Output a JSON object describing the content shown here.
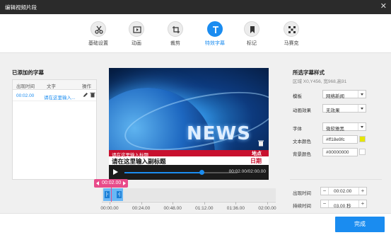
{
  "window": {
    "title": "编辑视频片段",
    "close_glyph": "✕"
  },
  "toolbar": {
    "items": [
      {
        "label": "基础设置",
        "icon": "scissors-icon"
      },
      {
        "label": "动画",
        "icon": "play-box-icon"
      },
      {
        "label": "裁剪",
        "icon": "crop-icon"
      },
      {
        "label": "特效字幕",
        "icon": "text-t-icon",
        "active": true
      },
      {
        "label": "标记",
        "icon": "bookmark-icon"
      },
      {
        "label": "马赛克",
        "icon": "mosaic-icon"
      }
    ]
  },
  "subtitles_panel": {
    "title": "已添加的字幕",
    "columns": [
      "出现时间",
      "文字",
      "操作"
    ],
    "rows": [
      {
        "time": "00:02.00",
        "text": "请在这里输入..."
      }
    ]
  },
  "preview": {
    "news_text": "NEWS",
    "caption_red_text": "请在这里输入标题",
    "caption_red_right": "地点",
    "caption_white_text": "请在这里输入副标题",
    "caption_white_right": "日期",
    "time_display": "00:02.00/02:00.00",
    "progress_fraction": 0.68
  },
  "timeline": {
    "current_time": "00:02.00",
    "clip_left_handle": "[‹",
    "clip_right_handle": "›]",
    "ticks": [
      "00:00.00",
      "00:24.00",
      "00:48.00",
      "01:12.00",
      "01:36.00",
      "02:00.00"
    ]
  },
  "style_panel": {
    "title": "所选字幕样式",
    "region": "区域 X0,Y456, 宽968,高91",
    "template_label": "模板",
    "template_value": "网络新闻",
    "animation_label": "动画效果",
    "animation_value": "无效果",
    "font_label": "字体",
    "font_value": "微软雅黑",
    "text_color_label": "文本颜色",
    "text_color_value": "#ff18e9fc",
    "text_color_swatch": "#e6e600",
    "bg_color_label": "背景颜色",
    "bg_color_value": "#00000000",
    "bg_color_swatch": "#ffffff",
    "appear_label": "出现时间",
    "appear_value": "00:02.00",
    "duration_label": "持续时间",
    "duration_value": "03.00 秒"
  },
  "footer": {
    "finish_label": "完成"
  },
  "colors": {
    "accent": "#1a8cf0",
    "caption_red": "#c8102e",
    "timeline_marker": "#e84b8a"
  }
}
